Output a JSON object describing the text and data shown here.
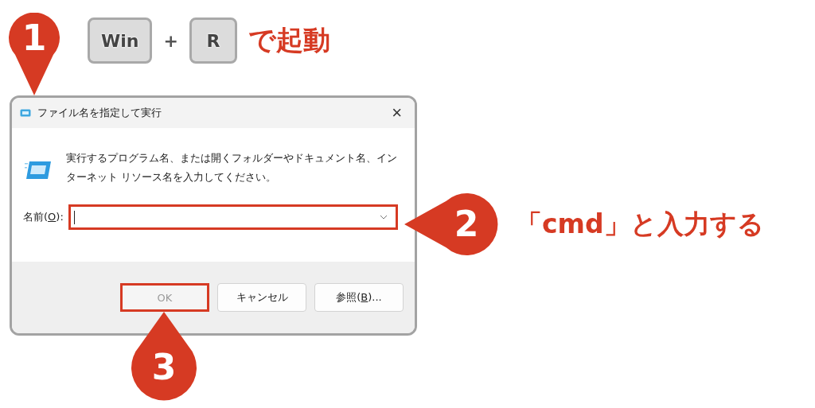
{
  "step_markers": [
    {
      "number": "1",
      "kind": "down"
    },
    {
      "number": "2",
      "kind": "left"
    },
    {
      "number": "3",
      "kind": "up"
    }
  ],
  "shortcut": {
    "keys": [
      "Win",
      "R"
    ],
    "joiner": "+",
    "caption": "で起動"
  },
  "instruction": "「cmd」と入力する",
  "window": {
    "title": "ファイル名を指定して実行",
    "close": "×",
    "description": "実行するプログラム名、または開くフォルダーやドキュメント名、インターネット リソース名を入力してください。",
    "name_label": {
      "before": "名前(",
      "access_key": "O",
      "after": "):"
    },
    "name_field": {
      "highlighted": true
    },
    "buttons": [
      {
        "before": "OK",
        "disabled": true,
        "highlighted": true
      },
      {
        "before": "キャンセル",
        "disabled": false,
        "highlighted": false
      },
      {
        "before": "参照(",
        "access_key": "B",
        "after": ")...",
        "disabled": false,
        "highlighted": false
      }
    ]
  }
}
